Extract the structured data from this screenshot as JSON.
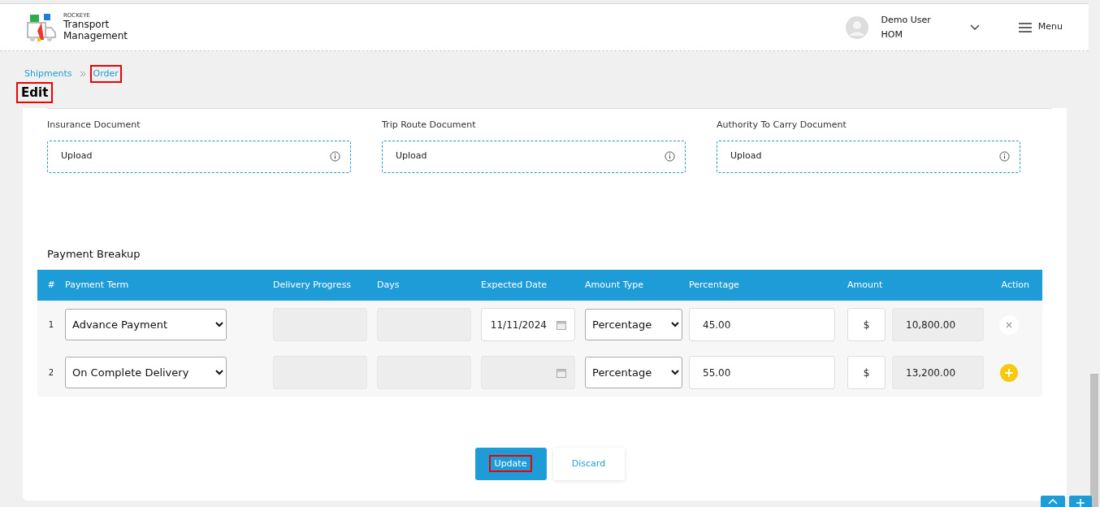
{
  "header": {
    "brand_small": "ROCKEYE",
    "brand_line1": "Transport",
    "brand_line2": "Management",
    "user_name": "Demo User",
    "user_role": "HOM",
    "menu_label": "Menu"
  },
  "breadcrumb": [
    {
      "label": "Shipments",
      "highlighted": false
    },
    {
      "label": "Order",
      "highlighted": true
    }
  ],
  "page_title": {
    "text": "Edit",
    "highlighted": true
  },
  "documents": [
    {
      "label": "Insurance Document",
      "button": "Upload"
    },
    {
      "label": "Trip Route Document",
      "button": "Upload"
    },
    {
      "label": "Authority To Carry Document",
      "button": "Upload"
    }
  ],
  "payment_breakup": {
    "title": "Payment Breakup",
    "columns": [
      "#",
      "Payment Term",
      "Delivery Progress",
      "Days",
      "Expected Date",
      "Amount Type",
      "Percentage",
      "Amount",
      "Action"
    ],
    "rows": [
      {
        "index": "1",
        "term": "Advance Payment",
        "expected_date": "11/11/2024",
        "date_disabled": false,
        "amount_type": "Percentage",
        "percentage": "45.00",
        "currency": "$",
        "amount": "10,800.00",
        "kind": "remove"
      },
      {
        "index": "2",
        "term": "On Complete Delivery",
        "date_disabled": true,
        "amount_type": "Percentage",
        "percentage": "55.00",
        "currency": "$",
        "amount": "13,200.00",
        "kind": "add"
      }
    ]
  },
  "buttons": [
    {
      "label": "Update",
      "kind": "primary",
      "highlighted": true
    },
    {
      "label": "Discard",
      "kind": "secondary",
      "highlighted": false
    }
  ]
}
